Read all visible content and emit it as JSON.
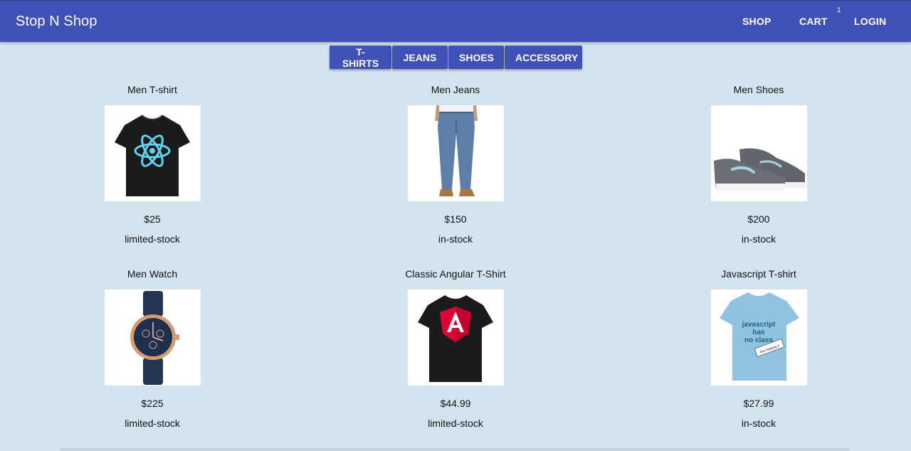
{
  "header": {
    "brand": "Stop N Shop",
    "nav": {
      "shop": "SHOP",
      "cart": "CART",
      "login": "LOGIN"
    },
    "cart_count": "1",
    "colors": {
      "appbar": "#3f51b5"
    }
  },
  "categories": [
    "T-SHIRTS",
    "JEANS",
    "SHOES",
    "ACCESSORY"
  ],
  "products": [
    {
      "name": "Men T-shirt",
      "price": "$25",
      "stock": "limited-stock",
      "image": "react-tshirt-icon"
    },
    {
      "name": "Men Jeans",
      "price": "$150",
      "stock": "in-stock",
      "image": "jeans-icon"
    },
    {
      "name": "Men Shoes",
      "price": "$200",
      "stock": "in-stock",
      "image": "sneaker-icon"
    },
    {
      "name": "Men Watch",
      "price": "$225",
      "stock": "limited-stock",
      "image": "watch-icon"
    },
    {
      "name": "Classic Angular T-Shirt",
      "price": "$44.99",
      "stock": "limited-stock",
      "image": "angular-tshirt-icon"
    },
    {
      "name": "Javascript T-shirt",
      "price": "$27.99",
      "stock": "in-stock",
      "image": "js-tshirt-icon",
      "image_text": [
        "javascript",
        "has",
        "no class",
        "the making it"
      ]
    }
  ]
}
